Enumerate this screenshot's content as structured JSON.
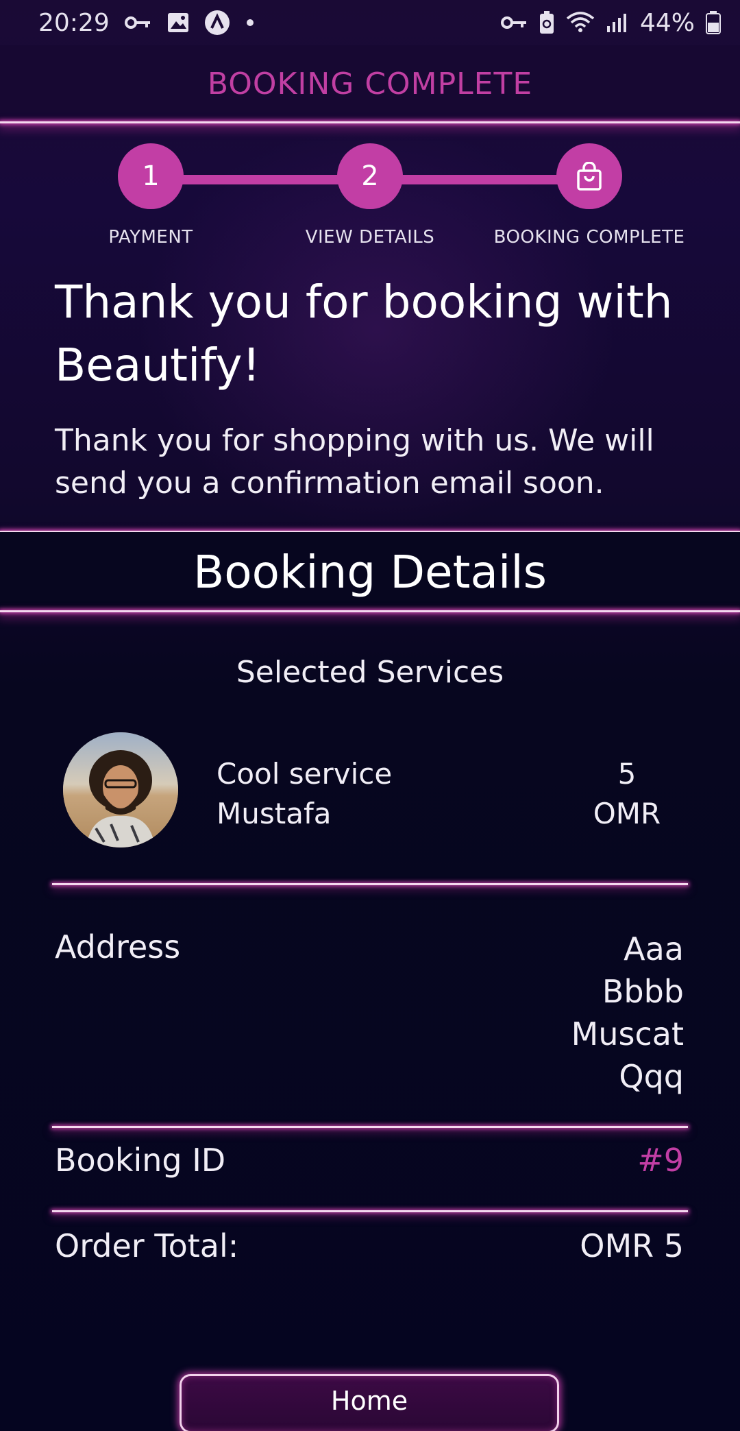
{
  "status_bar": {
    "time": "20:29",
    "battery": "44%",
    "icons_left": [
      "key-icon",
      "image-icon",
      "app-icon",
      "dot-icon"
    ],
    "icons_right": [
      "vpn-key-icon",
      "battery-saver-icon",
      "wifi-icon",
      "signal-icon",
      "battery-icon"
    ]
  },
  "header": {
    "title": "BOOKING COMPLETE"
  },
  "stepper": {
    "steps": [
      {
        "marker": "1",
        "label": "PAYMENT"
      },
      {
        "marker": "2",
        "label": "VIEW DETAILS"
      },
      {
        "marker": "shopping-bag-icon",
        "label": "BOOKING COMPLETE"
      }
    ]
  },
  "confirmation": {
    "title": "Thank you for booking with Beautify!",
    "message": "Thank you for shopping with us. We will send you a confirmation email soon."
  },
  "details": {
    "title": "Booking Details",
    "selected_services_heading": "Selected Services",
    "services": [
      {
        "name": "Cool service",
        "provider": "Mustafa",
        "price": "5",
        "currency": "OMR"
      }
    ],
    "address_label": "Address",
    "address_lines": [
      "Aaa",
      "Bbbb",
      "Muscat",
      "Qqq"
    ],
    "booking_id_label": "Booking ID",
    "booking_id_value": "#9",
    "order_total_label": "Order Total:",
    "order_total_value": "OMR 5"
  },
  "actions": {
    "home_label": "Home"
  },
  "colors": {
    "accent": "#c23ea5",
    "background": "#07061f",
    "neon_line": "#f4d9ef"
  }
}
